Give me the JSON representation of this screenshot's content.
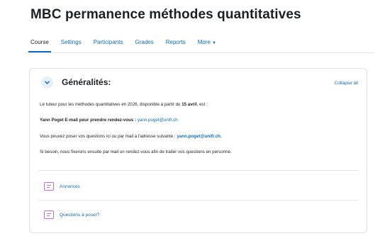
{
  "page": {
    "title": "MBC permanence méthodes quantitatives"
  },
  "nav": {
    "tabs": [
      {
        "label": "Course",
        "active": true
      },
      {
        "label": "Settings"
      },
      {
        "label": "Participants"
      },
      {
        "label": "Grades"
      },
      {
        "label": "Reports"
      },
      {
        "label": "More"
      }
    ]
  },
  "section": {
    "title": "Généralités:",
    "collapse_label": "Collapse all",
    "summary": {
      "p1_prefix": "Le tuteur pour les méthodes quantitatives en 2026, disponible à partir du ",
      "p1_bold": "15 avril",
      "p1_suffix": ", est :",
      "p2_bold": "Yann Poget E-mail pour prendre rendez-vous :",
      "p2_link": "yann.poget@unifr.ch",
      "p3_prefix": "Vous pouvez poser vos questions ici ou par mail à l'adresse suivante : ",
      "p3_link": "yann.poget@unifr.ch.",
      "p4": "Si besoin, nous fixerons ensuite par mail un rendez-vous afin de traiter vos questions en personne."
    },
    "activities": [
      {
        "label": "Annonces",
        "icon": "forum-icon"
      },
      {
        "label": "Questions à poser?",
        "icon": "forum-icon"
      }
    ]
  },
  "colors": {
    "accent": "#0f6cbf",
    "activity_icon": "#b96fd6"
  }
}
